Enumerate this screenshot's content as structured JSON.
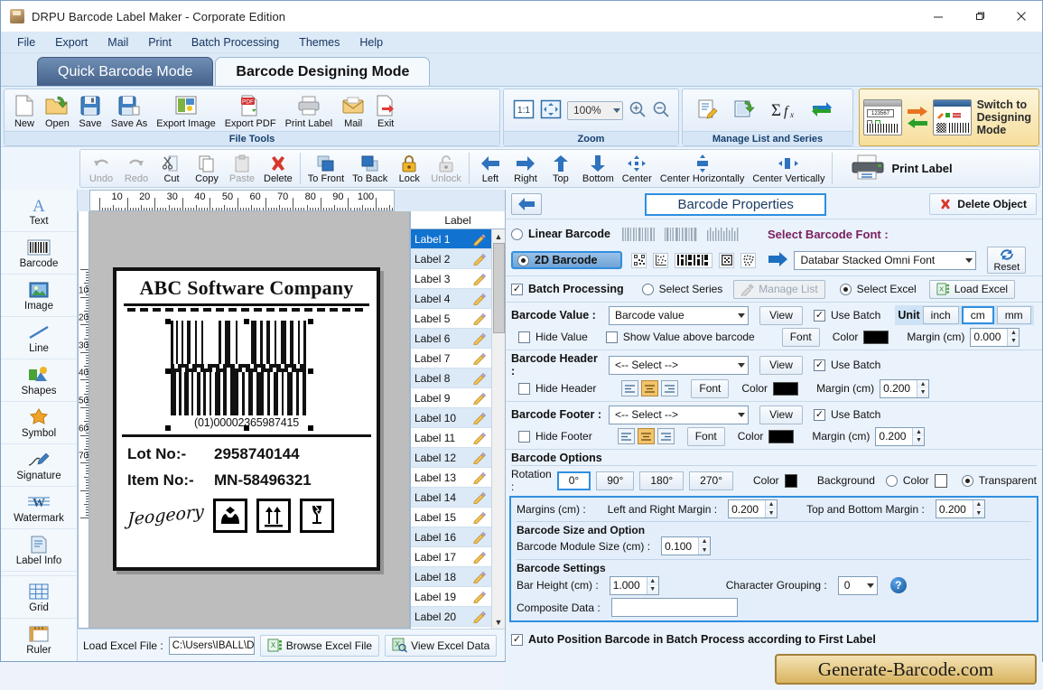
{
  "window": {
    "title": "DRPU Barcode Label Maker - Corporate Edition",
    "minimize": "—",
    "maximize": "❐",
    "close": "✕"
  },
  "menu": [
    "File",
    "Export",
    "Mail",
    "Print",
    "Batch Processing",
    "Themes",
    "Help"
  ],
  "modes": [
    {
      "label": "Quick Barcode Mode",
      "active": true
    },
    {
      "label": "Barcode Designing Mode",
      "active": false
    }
  ],
  "ribbon": {
    "file_tools": {
      "title": "File Tools",
      "buttons": [
        "New",
        "Open",
        "Save",
        "Save As",
        "Export Image",
        "Export PDF",
        "Print Label",
        "Mail",
        "Exit"
      ]
    },
    "zoom": {
      "title": "Zoom",
      "actual_size": "1:1",
      "fit_label": "fit-to-screen",
      "level": "100%",
      "zoom_in": "zoom-in",
      "zoom_out": "zoom-out"
    },
    "manage": {
      "title": "Manage List and Series",
      "buttons": [
        "manage-list",
        "export-list",
        "series-function",
        "swap"
      ]
    },
    "switch": {
      "line1": "Switch to",
      "line2": "Designing",
      "line3": "Mode",
      "mini_value": "123567"
    }
  },
  "toolbar2": {
    "edit": [
      "Undo",
      "Redo",
      "Cut",
      "Copy",
      "Paste",
      "Delete"
    ],
    "edit_disabled": [
      "Undo",
      "Redo",
      "Paste"
    ],
    "order": [
      "To Front",
      "To Back",
      "Lock",
      "Unlock"
    ],
    "order_disabled": [
      "Unlock"
    ],
    "align": [
      "Left",
      "Right",
      "Top",
      "Bottom",
      "Center",
      "Center Horizontally",
      "Center Vertically"
    ],
    "print_label": "Print Label"
  },
  "sidebar": {
    "items": [
      {
        "label": "Text",
        "icon": "text-icon"
      },
      {
        "label": "Barcode",
        "icon": "barcode-icon"
      },
      {
        "label": "Image",
        "icon": "image-icon"
      },
      {
        "label": "Line",
        "icon": "line-icon"
      },
      {
        "label": "Shapes",
        "icon": "shapes-icon"
      },
      {
        "label": "Symbol",
        "icon": "symbol-icon"
      },
      {
        "label": "Signature",
        "icon": "signature-icon"
      },
      {
        "label": "Watermark",
        "icon": "watermark-icon"
      },
      {
        "label": "Label Info",
        "icon": "label-info-icon"
      }
    ],
    "bottom": [
      {
        "label": "Grid",
        "icon": "grid-icon"
      },
      {
        "label": "Ruler",
        "icon": "ruler-icon"
      }
    ]
  },
  "canvas": {
    "hruler_ticks": [
      10,
      20,
      30,
      40,
      50,
      60,
      70,
      80,
      90,
      100
    ],
    "vruler_ticks": [
      10,
      20,
      30,
      40,
      50,
      60,
      70
    ],
    "label": {
      "company": "ABC Software Company",
      "barcode_value": "(01)00002365987415",
      "rows": [
        {
          "key": "Lot No:-",
          "value": "2958740144"
        },
        {
          "key": "Item No:-",
          "value": "MN-58496321"
        }
      ],
      "signature": "Jeogeory",
      "pack_icons": [
        "handle-with-care-icon",
        "this-way-up-icon",
        "fragile-icon"
      ]
    }
  },
  "label_list": {
    "header": "Label",
    "selected": "Label 1",
    "items": [
      "Label 1",
      "Label 2",
      "Label 3",
      "Label 4",
      "Label 5",
      "Label 6",
      "Label 7",
      "Label 8",
      "Label 9",
      "Label 10",
      "Label 11",
      "Label 12",
      "Label 13",
      "Label 14",
      "Label 15",
      "Label 16",
      "Label 17",
      "Label 18",
      "Label 19",
      "Label 20"
    ]
  },
  "excel_bar": {
    "load_label": "Load Excel File :",
    "path": "C:\\Users\\IBALL\\D",
    "browse": "Browse Excel File",
    "view": "View Excel Data"
  },
  "properties": {
    "back": "back-arrow",
    "title": "Barcode Properties",
    "delete_object": "Delete Object",
    "type": {
      "linear_label": "Linear Barcode",
      "linear_selected": false,
      "twod_label": "2D Barcode",
      "twod_selected": true,
      "font_section_label": "Select Barcode Font :",
      "font_value": "Databar Stacked Omni Font",
      "reset": "Reset"
    },
    "batch": {
      "batch_processing": "Batch Processing",
      "batch_checked": true,
      "select_series": "Select Series",
      "series_selected": false,
      "manage_list": "Manage List",
      "select_excel": "Select Excel",
      "excel_selected": true,
      "load_excel": "Load Excel"
    },
    "value_row": {
      "label": "Barcode Value :",
      "combo": "Barcode value",
      "view": "View",
      "use_batch": "Use Batch",
      "use_batch_checked": true,
      "unit_label": "Unit",
      "units": [
        "inch",
        "cm",
        "mm"
      ],
      "unit_selected": "cm",
      "hide_value": "Hide Value",
      "hide_value_checked": false,
      "show_above": "Show Value above barcode",
      "show_above_checked": false,
      "font": "Font",
      "color_label": "Color",
      "color": "#000000",
      "margin_label": "Margin (cm)",
      "margin": "0.000"
    },
    "header_row": {
      "label": "Barcode Header :",
      "combo": "<-- Select -->",
      "view": "View",
      "use_batch": "Use Batch",
      "use_batch_checked": true,
      "hide": "Hide Header",
      "hide_checked": false,
      "font": "Font",
      "color_label": "Color",
      "color": "#000000",
      "margin_label": "Margin (cm)",
      "margin": "0.200",
      "align_selected": "center"
    },
    "footer_row": {
      "label": "Barcode Footer :",
      "combo": "<-- Select -->",
      "view": "View",
      "use_batch": "Use Batch",
      "use_batch_checked": true,
      "hide": "Hide Footer",
      "hide_checked": false,
      "font": "Font",
      "color_label": "Color",
      "color": "#000000",
      "margin_label": "Margin (cm)",
      "margin": "0.200",
      "align_selected": "center"
    },
    "options": {
      "title": "Barcode Options",
      "rotation_label": "Rotation :",
      "rotations": [
        "0°",
        "90°",
        "180°",
        "270°"
      ],
      "rotation_selected": "0°",
      "color_label": "Color",
      "color": "#000000",
      "background_label": "Background",
      "bg_color_label": "Color",
      "bg_color": "#ffffff",
      "bg_transparent_label": "Transparent",
      "bg_transparent_selected": true
    },
    "margins": {
      "label": "Margins (cm) :",
      "lr_label": "Left and Right Margin :",
      "lr_value": "0.200",
      "tb_label": "Top and Bottom Margin :",
      "tb_value": "0.200"
    },
    "size_option": {
      "title": "Barcode Size and Option",
      "module_label": "Barcode Module Size (cm) :",
      "module_value": "0.100"
    },
    "settings": {
      "title": "Barcode Settings",
      "bar_height_label": "Bar Height (cm) :",
      "bar_height": "1.000",
      "char_group_label": "Character Grouping :",
      "char_group": "0",
      "help": "?",
      "composite_label": "Composite Data :",
      "composite_value": ""
    },
    "auto_position": "Auto Position Barcode in Batch Process according to First Label",
    "auto_position_checked": true,
    "brand": "Generate-Barcode.com"
  },
  "colors": {
    "accent": "#2f8fe0",
    "selection": "#1272d0",
    "ribbon_bg": "#e4eefa",
    "gold": "#d9b460"
  }
}
